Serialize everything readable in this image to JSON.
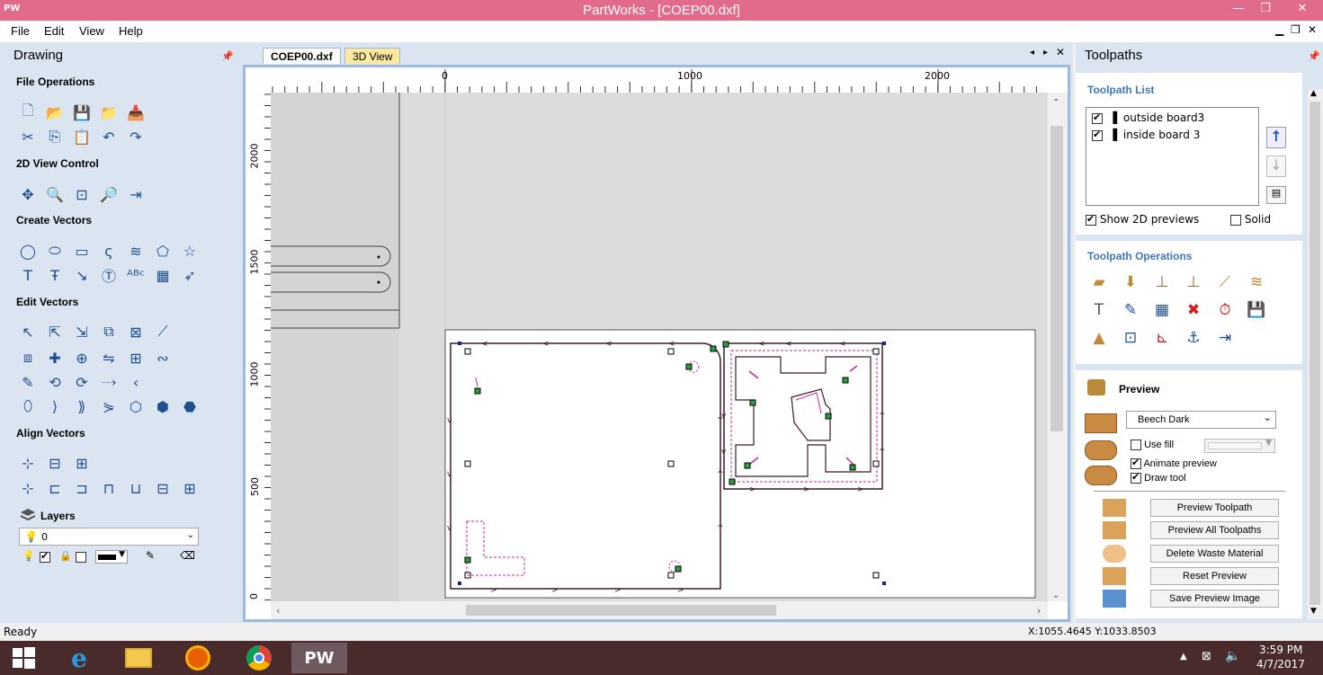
{
  "window": {
    "title": "PartWorks - [COEP00.dxf]",
    "app_icon": "PW"
  },
  "menu": [
    "File",
    "Edit",
    "View",
    "Help"
  ],
  "left_panel": {
    "title": "Drawing",
    "sections": {
      "file_ops": "File Operations",
      "view_control": "2D View Control",
      "create_vectors": "Create Vectors",
      "edit_vectors": "Edit Vectors",
      "align_vectors": "Align Vectors",
      "layers": "Layers"
    },
    "layer_value": "0"
  },
  "tabs": [
    "COEP00.dxf",
    "3D View"
  ],
  "ruler": {
    "h_ticks": [
      "0",
      "1000",
      "2000"
    ],
    "v_ticks": [
      "2000",
      "1500",
      "1000",
      "500",
      "0"
    ]
  },
  "right_panel": {
    "title": "Toolpaths",
    "toolpath_list_header": "Toolpath List",
    "toolpaths": [
      "outside board3",
      "inside board 3"
    ],
    "show_2d_previews": "Show 2D previews",
    "solid": "Solid",
    "toolpath_ops_header": "Toolpath Operations",
    "preview_header": "Preview",
    "material": "Beech Dark",
    "use_fill": "Use fill",
    "animate_preview": "Animate preview",
    "draw_tool": "Draw tool",
    "buttons": [
      "Preview Toolpath",
      "Preview All Toolpaths",
      "Delete Waste Material",
      "Reset Preview",
      "Save Preview Image"
    ]
  },
  "status": {
    "left": "Ready",
    "coords": "X:1055.4645 Y:1033.8503"
  },
  "taskbar": {
    "pw_label": "PW",
    "time": "3:59 PM",
    "date": "4/7/2017"
  },
  "colors": {
    "titlebar": "#e26b8b",
    "panel_bg": "#dbe5f1",
    "accent_blue": "#3e78b8",
    "toolpath_magenta": "#c0289a",
    "node_green": "#2e9b3c"
  }
}
